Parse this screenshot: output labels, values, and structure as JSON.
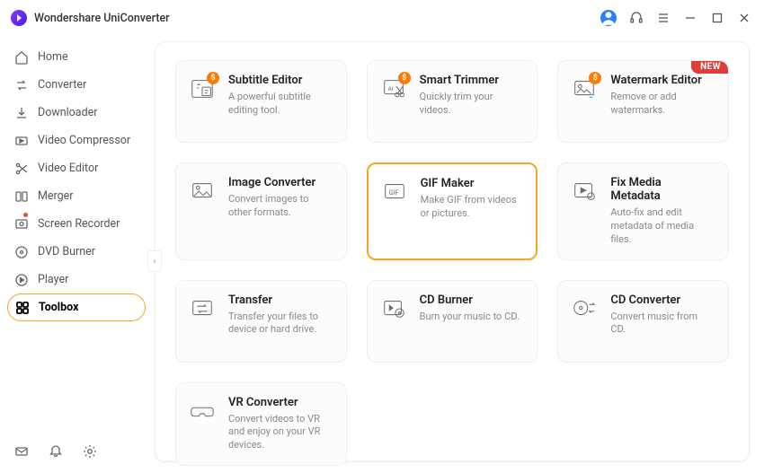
{
  "app": {
    "title": "Wondershare UniConverter"
  },
  "titlebar": {
    "new_badge": "NEW"
  },
  "sidebar": {
    "items": [
      {
        "id": "home",
        "label": "Home"
      },
      {
        "id": "converter",
        "label": "Converter"
      },
      {
        "id": "downloader",
        "label": "Downloader"
      },
      {
        "id": "compressor",
        "label": "Video Compressor"
      },
      {
        "id": "editor",
        "label": "Video Editor"
      },
      {
        "id": "merger",
        "label": "Merger"
      },
      {
        "id": "recorder",
        "label": "Screen Recorder"
      },
      {
        "id": "dvdburner",
        "label": "DVD Burner"
      },
      {
        "id": "player",
        "label": "Player"
      },
      {
        "id": "toolbox",
        "label": "Toolbox"
      }
    ],
    "active": "toolbox"
  },
  "tools": [
    {
      "id": "subtitle",
      "title": "Subtitle Editor",
      "desc": "A powerful subtitle editing tool.",
      "dollar": true
    },
    {
      "id": "trimmer",
      "title": "Smart Trimmer",
      "desc": "Quickly trim your videos.",
      "dollar": true
    },
    {
      "id": "watermark",
      "title": "Watermark Editor",
      "desc": "Remove or add watermarks.",
      "dollar": true,
      "new": true
    },
    {
      "id": "imgconv",
      "title": "Image Converter",
      "desc": "Convert images to other formats."
    },
    {
      "id": "gifmaker",
      "title": "GIF Maker",
      "desc": "Make GIF from videos or pictures.",
      "highlight": true
    },
    {
      "id": "metadata",
      "title": "Fix Media Metadata",
      "desc": "Auto-fix and edit metadata of media files."
    },
    {
      "id": "transfer",
      "title": "Transfer",
      "desc": "Transfer your files to device or hard drive."
    },
    {
      "id": "cdburner",
      "title": "CD Burner",
      "desc": "Burn your music to CD."
    },
    {
      "id": "cdconv",
      "title": "CD Converter",
      "desc": "Convert music from CD."
    },
    {
      "id": "vrconv",
      "title": "VR Converter",
      "desc": "Convert videos to VR and enjoy on your VR devices."
    }
  ]
}
